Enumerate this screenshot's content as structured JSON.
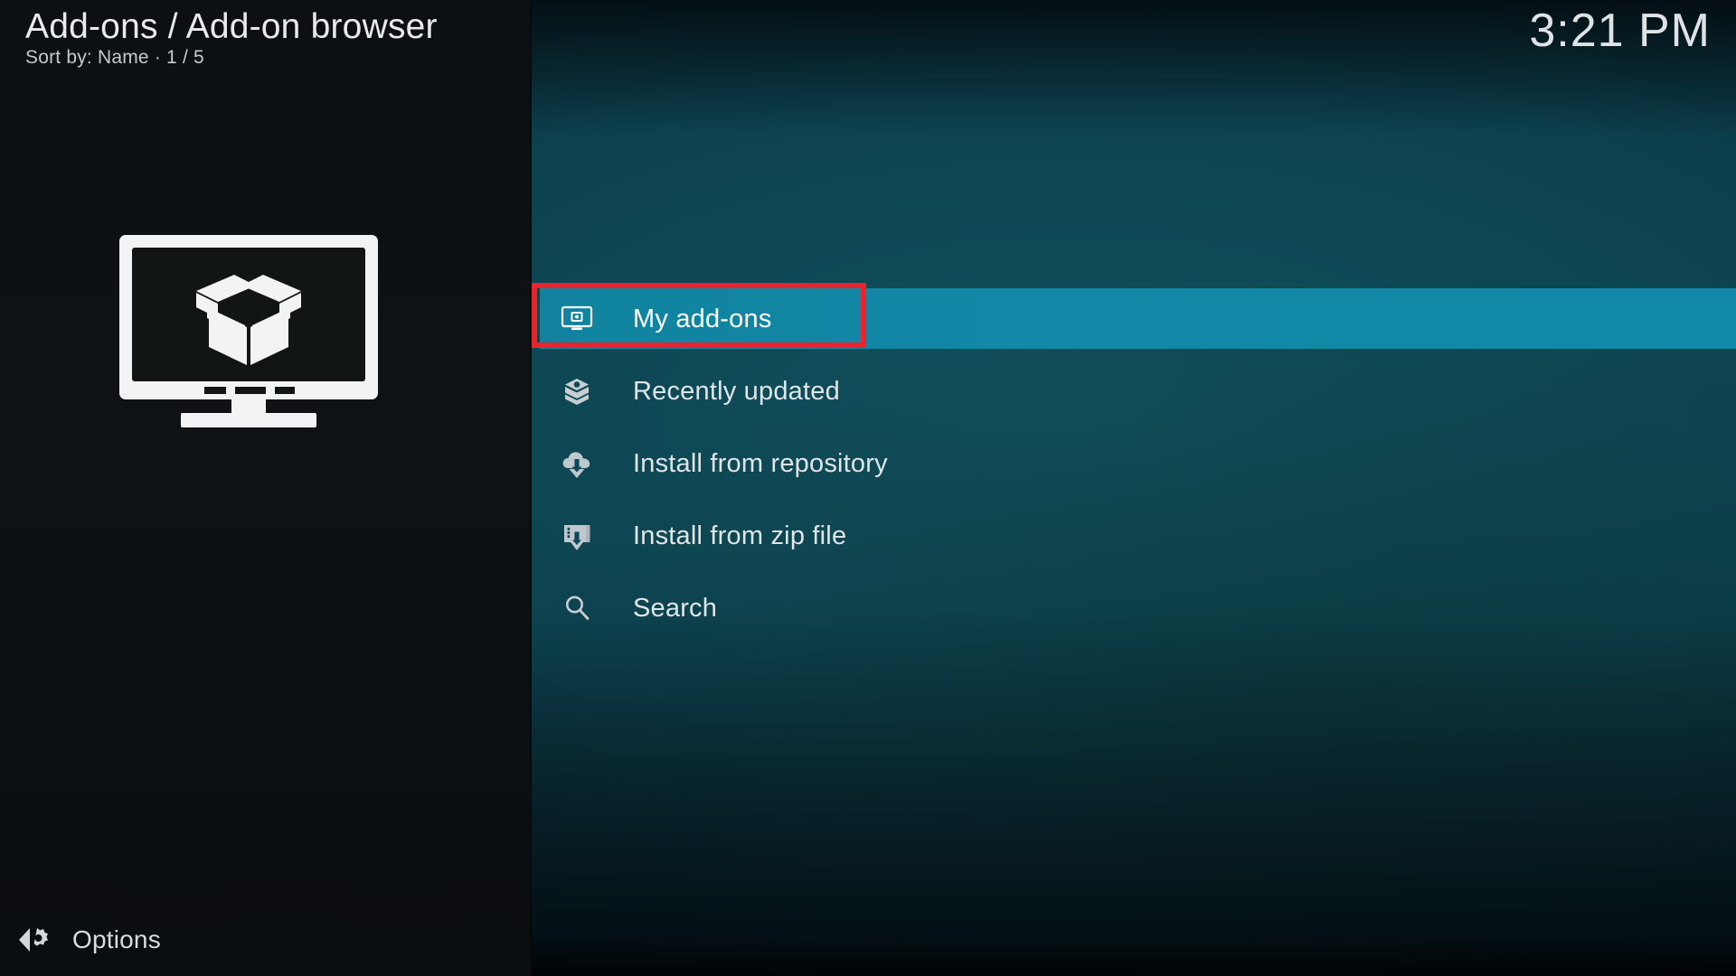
{
  "header": {
    "title": "Add-ons / Add-on browser",
    "sort_label": "Sort by: Name",
    "separator": "·",
    "position": "1 / 5",
    "clock": "3:21 PM"
  },
  "poster": {
    "icon": "tv-addon-box-icon"
  },
  "menu": {
    "items": [
      {
        "label": "My add-ons",
        "icon": "monitor-addon-icon",
        "selected": true
      },
      {
        "label": "Recently updated",
        "icon": "open-box-icon",
        "selected": false
      },
      {
        "label": "Install from repository",
        "icon": "cloud-download-icon",
        "selected": false
      },
      {
        "label": "Install from zip file",
        "icon": "zip-download-icon",
        "selected": false
      },
      {
        "label": "Search",
        "icon": "search-icon",
        "selected": false
      }
    ]
  },
  "footer": {
    "options_label": "Options",
    "icon": "options-gear-icon"
  },
  "colors": {
    "selection": "#1289a8",
    "annotation": "#e8242e",
    "panel": "#0e1214",
    "text": "#dfe6ea"
  }
}
